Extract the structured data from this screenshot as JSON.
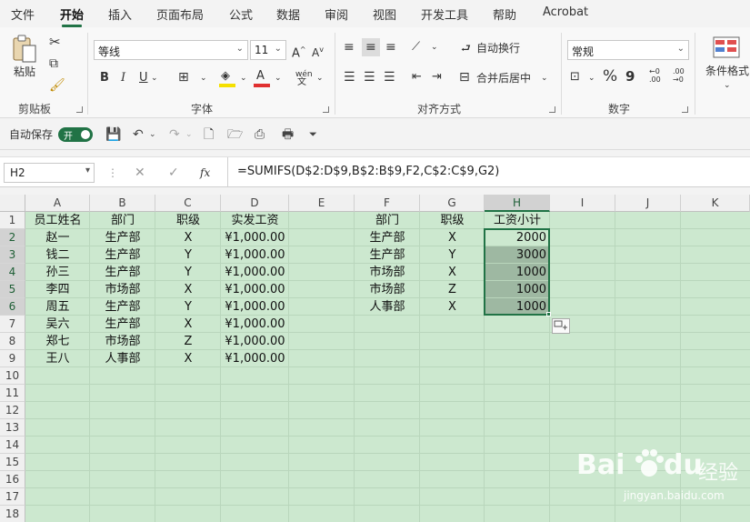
{
  "menu": [
    "文件",
    "开始",
    "插入",
    "页面布局",
    "公式",
    "数据",
    "审阅",
    "视图",
    "开发工具",
    "帮助",
    "Acrobat"
  ],
  "ribbon": {
    "clipboard": {
      "label": "剪贴板",
      "paste": "粘贴"
    },
    "font": {
      "label": "字体",
      "name": "等线",
      "size": "11",
      "bold": "B",
      "italic": "I",
      "underline": "U",
      "grow": "A",
      "shrink": "A",
      "font_color": "A",
      "phonetic": "wén"
    },
    "alignment": {
      "label": "对齐方式",
      "wrap": "自动换行",
      "merge": "合并后居中"
    },
    "number": {
      "label": "数字",
      "format": "常规",
      "percent": "%",
      "comma": "9",
      "inc": "←0 .00",
      "dec": ".00 →0"
    },
    "styles": {
      "conditional": "条件格式"
    }
  },
  "qat": {
    "autosave_label": "自动保存",
    "toggle": "开"
  },
  "formula_bar": {
    "name_box": "H2",
    "cancel": "✕",
    "enter": "✓",
    "fx": "fx",
    "formula": "=SUMIFS(D$2:D$9,B$2:B$9,F2,C$2:C$9,G2)"
  },
  "sheet": {
    "columns": [
      "A",
      "B",
      "C",
      "D",
      "E",
      "F",
      "G",
      "H",
      "I",
      "J",
      "K"
    ],
    "selected_column": "H",
    "rows": [
      "1",
      "2",
      "3",
      "4",
      "5",
      "6",
      "7",
      "8",
      "9",
      "10",
      "11",
      "12",
      "13",
      "14",
      "15",
      "16",
      "17",
      "18"
    ],
    "left_table": [
      [
        "员工姓名",
        "部门",
        "职级",
        "实发工资"
      ],
      [
        "赵一",
        "生产部",
        "X",
        "¥1,000.00"
      ],
      [
        "钱二",
        "生产部",
        "Y",
        "¥1,000.00"
      ],
      [
        "孙三",
        "生产部",
        "Y",
        "¥1,000.00"
      ],
      [
        "李四",
        "市场部",
        "X",
        "¥1,000.00"
      ],
      [
        "周五",
        "生产部",
        "Y",
        "¥1,000.00"
      ],
      [
        "吴六",
        "生产部",
        "X",
        "¥1,000.00"
      ],
      [
        "郑七",
        "市场部",
        "Z",
        "¥1,000.00"
      ],
      [
        "王八",
        "人事部",
        "X",
        "¥1,000.00"
      ]
    ],
    "right_table": [
      [
        "部门",
        "职级",
        "工资小计"
      ],
      [
        "生产部",
        "X",
        "2000"
      ],
      [
        "生产部",
        "Y",
        "3000"
      ],
      [
        "市场部",
        "X",
        "1000"
      ],
      [
        "市场部",
        "Z",
        "1000"
      ],
      [
        "人事部",
        "X",
        "1000"
      ]
    ]
  },
  "watermark": {
    "brand": "Bai",
    "brand2": "du",
    "cn": "经验",
    "url": "jingyan.baidu.com"
  },
  "colors": {
    "accent": "#217346",
    "sheet_bg": "#cce8cf",
    "selection": "#9eb8a2",
    "font_color_bar": "#e03030",
    "highlight_bar": "#f5e000"
  }
}
